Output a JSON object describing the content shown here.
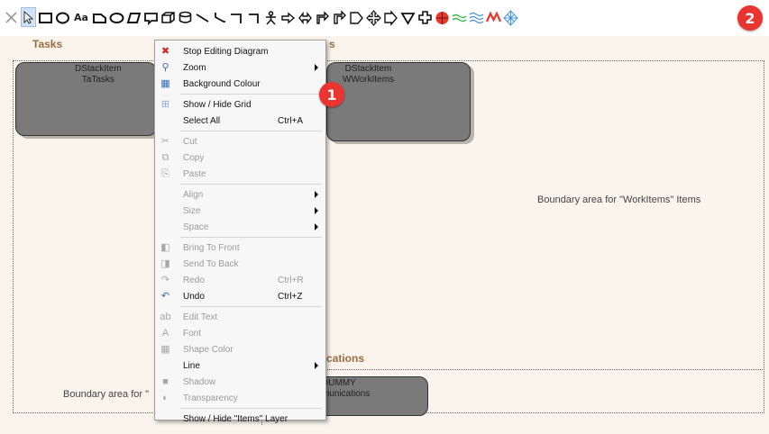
{
  "toolbar": {
    "tools": [
      {
        "name": "close-tool-icon"
      },
      {
        "name": "pointer-tool-icon"
      },
      {
        "name": "rectangle-tool-icon"
      },
      {
        "name": "ellipse-tool-icon"
      },
      {
        "name": "text-tool-icon",
        "text": "Aa"
      },
      {
        "name": "rounded-rect-tool-icon"
      },
      {
        "name": "oval-tool-icon"
      },
      {
        "name": "parallelogram-tool-icon"
      },
      {
        "name": "callout-tool-icon"
      },
      {
        "name": "cube-tool-icon"
      },
      {
        "name": "cylinder-tool-icon"
      },
      {
        "name": "line-tool-icon"
      },
      {
        "name": "connector-tool-icon"
      },
      {
        "name": "elbow-connector-tool-icon"
      },
      {
        "name": "corner-connector-tool-icon"
      },
      {
        "name": "actor-tool-icon"
      },
      {
        "name": "arrow-right-tool-icon"
      },
      {
        "name": "double-arrow-tool-icon"
      },
      {
        "name": "bent-arrow-tool-icon"
      },
      {
        "name": "bent-arrow-2-tool-icon"
      },
      {
        "name": "pentagon-arrow-tool-icon"
      },
      {
        "name": "quad-arrow-tool-icon"
      },
      {
        "name": "block-arrow-tool-icon"
      },
      {
        "name": "triangle-tool-icon"
      },
      {
        "name": "cross-tool-icon"
      },
      {
        "name": "target-tool-icon"
      },
      {
        "name": "wave-tool-icon"
      },
      {
        "name": "triple-wave-tool-icon"
      },
      {
        "name": "zigzag-tool-icon"
      },
      {
        "name": "mesh-tool-icon"
      }
    ],
    "accent_red": "#e8382c",
    "accent_green": "#39b54a",
    "accent_blue": "#4a90d9"
  },
  "badges": {
    "one": "1",
    "two": "2"
  },
  "canvas": {
    "layer_tasks_title": "Tasks",
    "layer_workitems_title_fragment": "s",
    "layer_communications_title_fragment": "cations",
    "lane_tasks_text_line1": "DStackItem",
    "lane_tasks_text_line2": "TaTasks",
    "lane_workitems_text_line1": "DStackItem",
    "lane_workitems_text_line2": "WWorkItems",
    "lane_comms_text_line1": "DUMMY",
    "lane_comms_text_line2": "munications",
    "boundary_workitems": "Boundary area for \"WorkItems\" Items",
    "boundary_comms_fragment": "Boundary area for \""
  },
  "menu": {
    "groups": [
      [
        {
          "label": "Stop Editing Diagram",
          "icon": "close-icon",
          "glyph": "✖",
          "enabled": true
        },
        {
          "label": "Zoom",
          "icon": "zoom-icon",
          "glyph": "⚲",
          "enabled": true,
          "submenu": true
        },
        {
          "label": "Background Colour",
          "icon": "background-colour-icon",
          "glyph": "▦",
          "enabled": true
        }
      ],
      [
        {
          "label": "Show / Hide Grid",
          "icon": "grid-icon",
          "glyph": "⊞",
          "enabled": true
        },
        {
          "label": "Select All",
          "shortcut": "Ctrl+A",
          "enabled": true
        }
      ],
      [
        {
          "label": "Cut",
          "icon": "cut-icon",
          "glyph": "✂",
          "enabled": false
        },
        {
          "label": "Copy",
          "icon": "copy-icon",
          "glyph": "⧉",
          "enabled": false
        },
        {
          "label": "Paste",
          "icon": "paste-icon",
          "glyph": "⎘",
          "enabled": false
        }
      ],
      [
        {
          "label": "Align",
          "enabled": false,
          "submenu": true
        },
        {
          "label": "Size",
          "enabled": false,
          "submenu": true
        },
        {
          "label": "Space",
          "enabled": false,
          "submenu": true
        }
      ],
      [
        {
          "label": "Bring To Front",
          "icon": "bring-to-front-icon",
          "glyph": "◧",
          "enabled": false
        },
        {
          "label": "Send To Back",
          "icon": "send-to-back-icon",
          "glyph": "◨",
          "enabled": false
        },
        {
          "label": "Redo",
          "shortcut": "Ctrl+R",
          "icon": "redo-icon",
          "glyph": "↷",
          "enabled": false
        },
        {
          "label": "Undo",
          "shortcut": "Ctrl+Z",
          "icon": "undo-icon",
          "glyph": "↶",
          "enabled": true
        }
      ],
      [
        {
          "label": "Edit Text",
          "icon": "edit-text-icon",
          "glyph": "ab",
          "enabled": false
        },
        {
          "label": "Font",
          "icon": "font-icon",
          "glyph": "A",
          "enabled": false
        },
        {
          "label": "Shape Color",
          "icon": "shape-color-icon",
          "glyph": "▦",
          "enabled": false
        },
        {
          "label": "Line",
          "enabled": true,
          "submenu": true
        },
        {
          "label": "Shadow",
          "icon": "shadow-icon",
          "glyph": "■",
          "enabled": false
        },
        {
          "label": "Transparency",
          "icon": "transparency-icon",
          "glyph": "◐",
          "enabled": false
        }
      ],
      [
        {
          "label": "Show / Hide \"Items\" Layer",
          "enabled": true
        }
      ]
    ]
  }
}
